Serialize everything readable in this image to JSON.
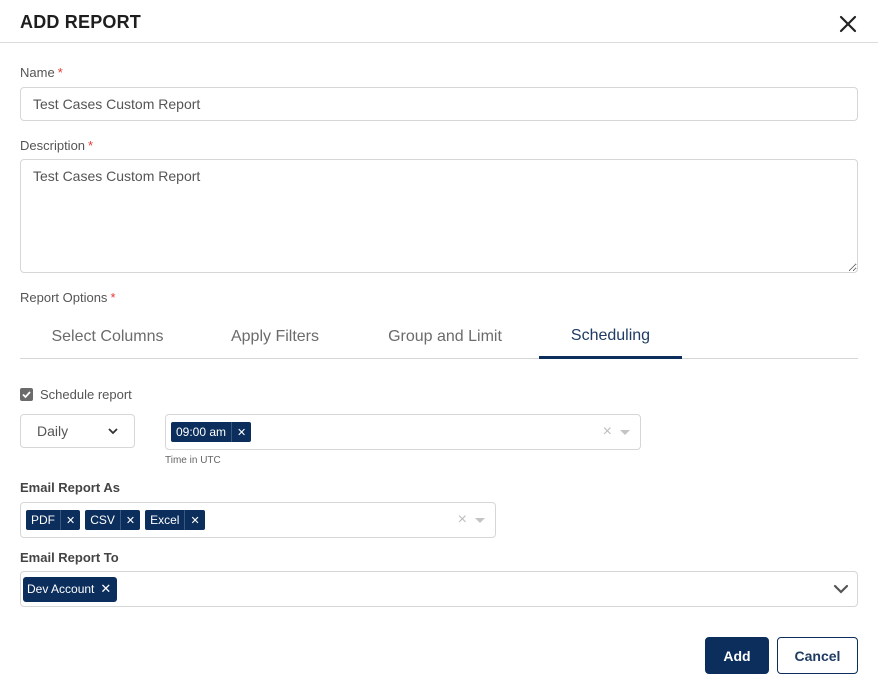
{
  "dialog": {
    "title": "ADD REPORT",
    "close_icon": "close-icon"
  },
  "form": {
    "name_label": "Name",
    "name_value": "Test Cases Custom Report",
    "description_label": "Description",
    "description_value": "Test Cases Custom Report",
    "report_options_label": "Report Options",
    "required_marker": "*"
  },
  "tabs": [
    {
      "label": "Select Columns",
      "active": false
    },
    {
      "label": "Apply Filters",
      "active": false
    },
    {
      "label": "Group and Limit",
      "active": false
    },
    {
      "label": "Scheduling",
      "active": true
    }
  ],
  "scheduling": {
    "schedule_checkbox_label": "Schedule report",
    "schedule_checked": true,
    "frequency_value": "Daily",
    "times": [
      "09:00 am"
    ],
    "time_hint": "Time in UTC",
    "email_as_label": "Email Report As",
    "email_formats": [
      "PDF",
      "CSV",
      "Excel"
    ],
    "email_to_label": "Email Report To",
    "recipients": [
      "Dev Account"
    ]
  },
  "buttons": {
    "add": "Add",
    "cancel": "Cancel"
  },
  "colors": {
    "primary": "#0b2e5c",
    "required": "#e53935"
  }
}
